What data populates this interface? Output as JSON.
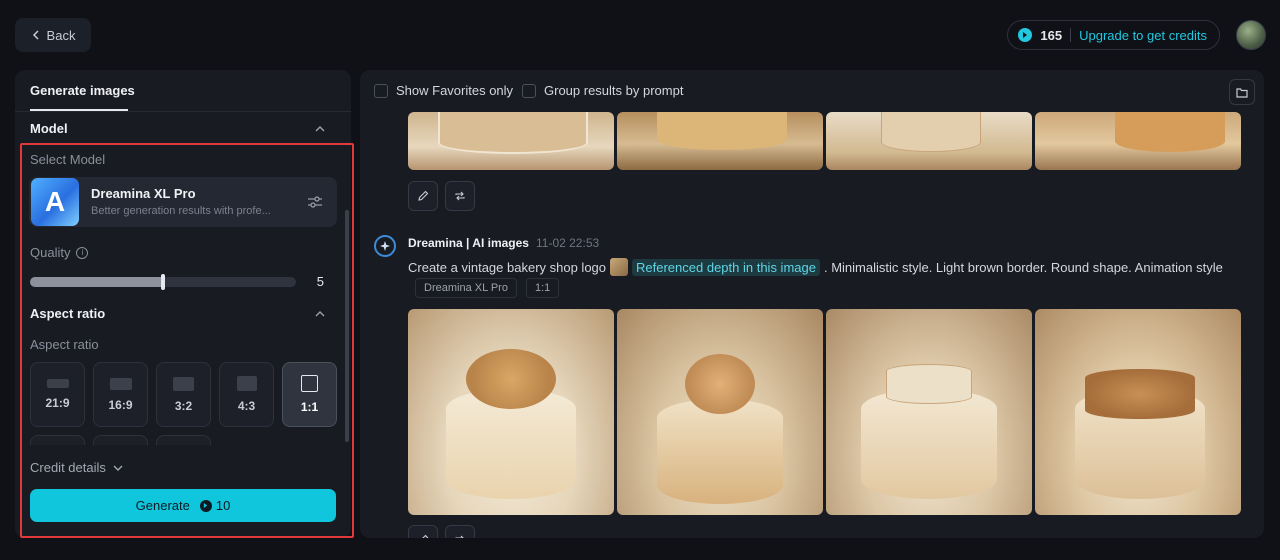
{
  "topbar": {
    "back_label": "Back",
    "credits_count": "165",
    "upgrade_label": "Upgrade to get credits"
  },
  "left_panel": {
    "tab_label": "Generate images",
    "model_section": "Model",
    "select_model_label": "Select Model",
    "model": {
      "name": "Dreamina XL Pro",
      "description": "Better generation results with profe..."
    },
    "quality_label": "Quality",
    "quality_value": "5",
    "quality_fraction": 0.5,
    "aspect_section": "Aspect ratio",
    "aspect_label": "Aspect ratio",
    "ratios": [
      "21:9",
      "16:9",
      "3:2",
      "4:3",
      "1:1"
    ],
    "selected_ratio": "1:1",
    "credit_details_label": "Credit details",
    "generate_label": "Generate",
    "generate_cost": "10"
  },
  "right_panel": {
    "show_favorites_label": "Show Favorites only",
    "group_results_label": "Group results by prompt",
    "generation": {
      "author": "Dreamina | AI images",
      "time": "11-02  22:53",
      "prompt_prefix": "Create a vintage bakery shop logo",
      "ref_chip": "Referenced depth in this image",
      "prompt_suffix": ". Minimalistic style. Light brown border. Round shape. Animation style",
      "tags": [
        "Dreamina XL Pro",
        "1:1"
      ]
    }
  },
  "colors": {
    "accent": "#0fc6dd",
    "highlight": "#e0383b",
    "background": "#0f1116",
    "panel": "#181b22"
  }
}
